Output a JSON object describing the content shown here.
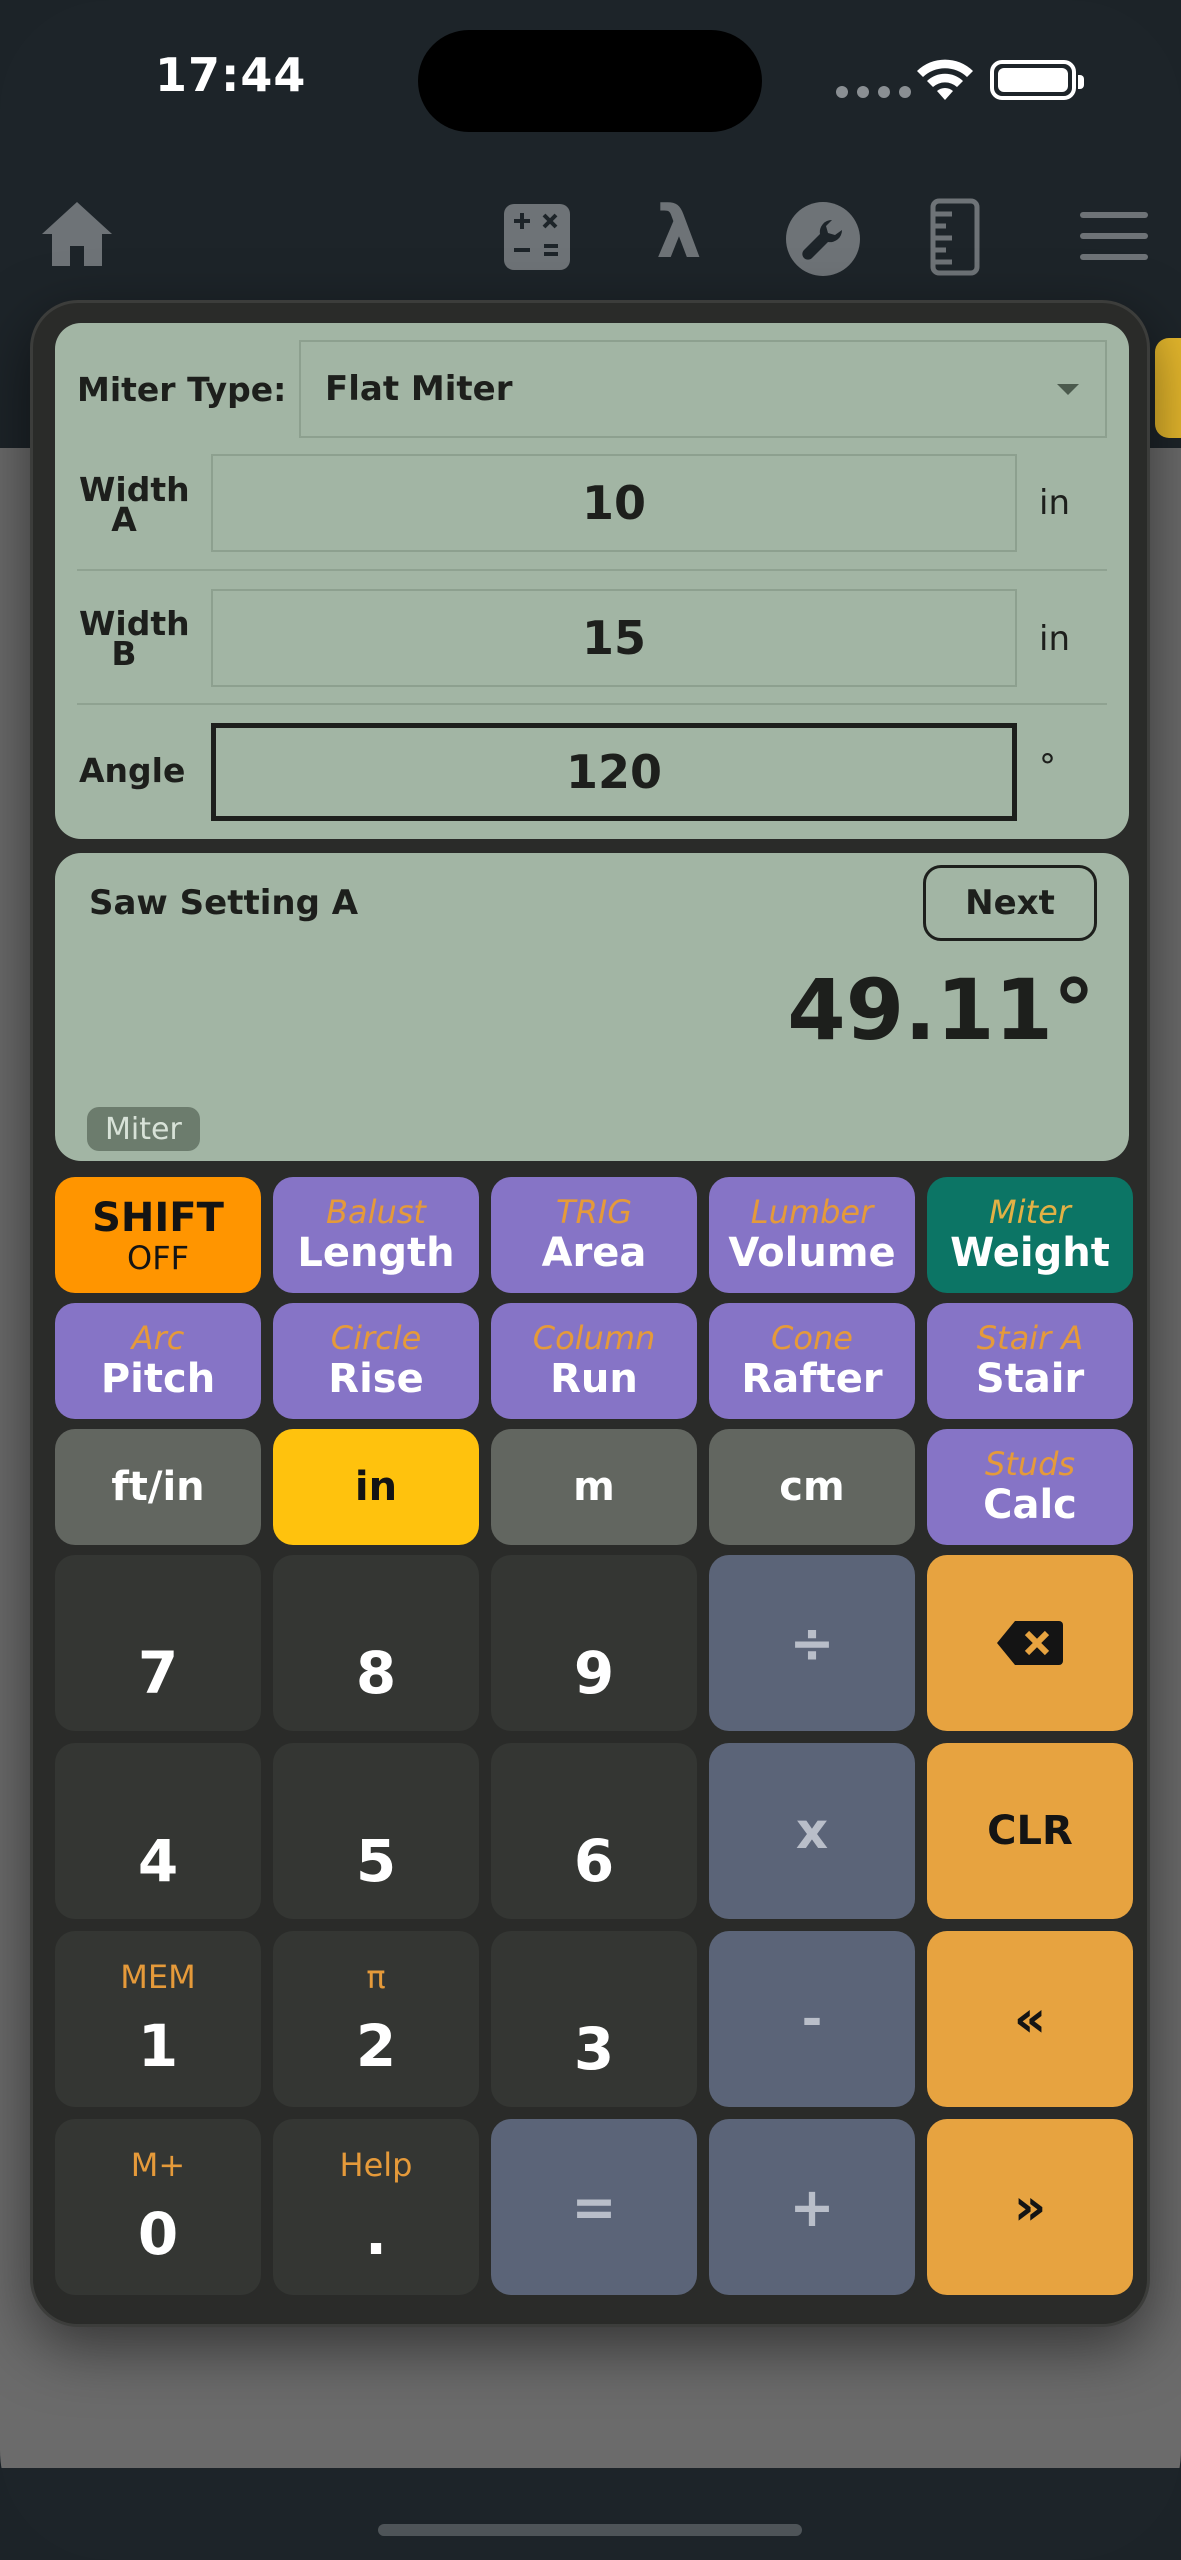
{
  "status_bar": {
    "time": "17:44"
  },
  "nav": {
    "icons": [
      "home-icon",
      "calculator-icon",
      "lambda-icon",
      "wrench-icon",
      "ruler-icon",
      "menu-icon"
    ],
    "lambda_glyph": "λ"
  },
  "inputs": {
    "miter_type_label": "Miter Type:",
    "miter_type_value": "Flat Miter",
    "width_a_label_1": "Width",
    "width_a_label_2": "A",
    "width_a_value": "10",
    "width_a_unit": "in",
    "width_b_label_1": "Width",
    "width_b_label_2": "B",
    "width_b_value": "15",
    "width_b_unit": "in",
    "angle_label": "Angle",
    "angle_value": "120",
    "angle_unit": "°"
  },
  "result": {
    "title": "Saw Setting A",
    "next_label": "Next",
    "value": "49.11°",
    "mode_badge": "Miter"
  },
  "keypad": {
    "row1": [
      {
        "sub": "",
        "main": "SHIFT",
        "main2": "OFF"
      },
      {
        "sub": "Balust",
        "main": "Length"
      },
      {
        "sub": "TRIG",
        "main": "Area"
      },
      {
        "sub": "Lumber",
        "main": "Volume"
      },
      {
        "sub": "Miter",
        "main": "Weight"
      }
    ],
    "row2": [
      {
        "sub": "Arc",
        "main": "Pitch"
      },
      {
        "sub": "Circle",
        "main": "Rise"
      },
      {
        "sub": "Column",
        "main": "Run"
      },
      {
        "sub": "Cone",
        "main": "Rafter"
      },
      {
        "sub": "Stair A",
        "main": "Stair"
      }
    ],
    "row3": [
      {
        "main": "ft/in"
      },
      {
        "main": "in"
      },
      {
        "main": "m"
      },
      {
        "main": "cm"
      },
      {
        "sub": "Studs",
        "main": "Calc"
      }
    ],
    "digits": {
      "k7": "7",
      "k8": "8",
      "k9": "9",
      "k4": "4",
      "k5": "5",
      "k6": "6",
      "k1": "1",
      "k2": "2",
      "k3": "3",
      "k0": "0",
      "kdot": ".",
      "mem_label": "MEM",
      "pi_label": "π",
      "mplus_label": "M+",
      "help_label": "Help"
    },
    "ops": {
      "divide": "÷",
      "multiply": "x",
      "minus": "-",
      "plus": "+",
      "equals": "="
    },
    "right": {
      "clr": "CLR",
      "prev": "«",
      "next": "»"
    }
  },
  "colors": {
    "panel": "#a2b5a4",
    "purple": "#8674c6",
    "teal": "#0c7565",
    "shift": "#ff9500",
    "unit_active": "#ffc20d",
    "amber": "#e7a340",
    "operator": "#5b6478"
  }
}
